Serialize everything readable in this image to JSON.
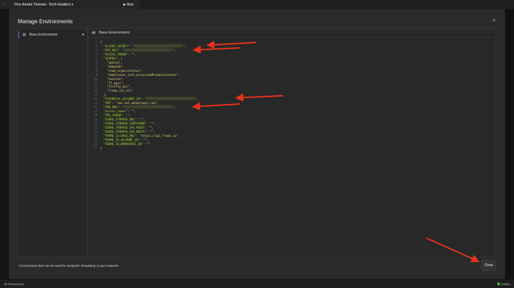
{
  "topbar": {
    "back_icon": "chevron-left-icon",
    "title": "One Adobe Tutorial - Tech Insiders ▾",
    "run": "▶ Run"
  },
  "modal": {
    "title": "Manage Environments",
    "close_icon": "×",
    "sidebar": {
      "items": [
        {
          "label": "Base Environment"
        }
      ]
    },
    "editor": {
      "title": "Base Environment",
      "lines": [
        [
          [
            "p",
            "{"
          ]
        ],
        [
          [
            "k",
            "  \"CLIENT_SECRET\""
          ],
          [
            "p",
            ": "
          ],
          [
            "s",
            "\""
          ],
          [
            "r",
            ""
          ],
          [
            "s",
            "\""
          ],
          [
            "p",
            ","
          ]
        ],
        [
          [
            "k",
            "  \"API_KEY\""
          ],
          [
            "p",
            ": "
          ],
          [
            "s",
            "\""
          ],
          [
            "r",
            ""
          ],
          [
            "s",
            "\""
          ],
          [
            "p",
            ","
          ]
        ],
        [
          [
            "k",
            "  \"ACCESS_TOKEN\""
          ],
          [
            "p",
            ": "
          ],
          [
            "s",
            "\"\""
          ],
          [
            "p",
            ","
          ]
        ],
        [
          [
            "k",
            "  \"SCOPES\""
          ],
          [
            "p",
            ": ["
          ]
        ],
        [
          [
            "s",
            "    \"openid\""
          ],
          [
            "p",
            ","
          ]
        ],
        [
          [
            "s",
            "    \"AdobeID\""
          ],
          [
            "p",
            ","
          ]
        ],
        [
          [
            "s",
            "    \"read_organizations\""
          ],
          [
            "p",
            ","
          ]
        ],
        [
          [
            "s",
            "    \"additional_info.projectedProductContext\""
          ],
          [
            "p",
            ","
          ]
        ],
        [
          [
            "s",
            "    \"session\""
          ],
          [
            "p",
            ","
          ]
        ],
        [
          [
            "s",
            "    \"ff_apis\""
          ],
          [
            "p",
            ","
          ]
        ],
        [
          [
            "s",
            "    \"firefly_api\""
          ],
          [
            "p",
            ","
          ]
        ],
        [
          [
            "s",
            "    \"frame.s2s.all\""
          ]
        ],
        [
          [
            "p",
            "  ],"
          ]
        ],
        [
          [
            "k",
            "  \"TECHNICAL_ACCOUNT_ID\""
          ],
          [
            "p",
            ": "
          ],
          [
            "s",
            "\""
          ],
          [
            "r",
            ""
          ],
          [
            "s",
            "\""
          ],
          [
            "p",
            ","
          ]
        ],
        [
          [
            "k",
            "  \"IMS\""
          ],
          [
            "p",
            ": "
          ],
          [
            "s",
            "\"ims-na1.adobelogin.com\""
          ],
          [
            "p",
            ","
          ]
        ],
        [
          [
            "k",
            "  \"IMS_ORG\""
          ],
          [
            "p",
            ": "
          ],
          [
            "s",
            "\""
          ],
          [
            "r",
            ""
          ],
          [
            "s",
            "\""
          ],
          [
            "p",
            ","
          ]
        ],
        [
          [
            "k",
            "  \"access_token\""
          ],
          [
            "p",
            ": "
          ],
          [
            "s",
            "\"\""
          ],
          [
            "p",
            ","
          ]
        ],
        [
          [
            "k",
            "  \"IMS_TOKEN\""
          ],
          [
            "p",
            ": "
          ],
          [
            "s",
            "\"\""
          ],
          [
            "p",
            ","
          ]
        ],
        [
          [
            "k",
            "  \"AZURE_STORAGE_URL\""
          ],
          [
            "p",
            ": "
          ],
          [
            "s",
            "\"\""
          ],
          [
            "p",
            ","
          ]
        ],
        [
          [
            "k",
            "  \"AZURE_STORAGE_CONTAINER\""
          ],
          [
            "p",
            ": "
          ],
          [
            "s",
            "\"\""
          ],
          [
            "p",
            ","
          ]
        ],
        [
          [
            "k",
            "  \"AZURE_STORAGE_SAS_READ\""
          ],
          [
            "p",
            ": "
          ],
          [
            "s",
            "\"\""
          ],
          [
            "p",
            ","
          ]
        ],
        [
          [
            "k",
            "  \"AZURE_STORAGE_SAS_WRITE\""
          ],
          [
            "p",
            ": "
          ],
          [
            "s",
            "\"\""
          ],
          [
            "p",
            ","
          ]
        ],
        [
          [
            "k",
            "  \"FRAME_IO_BASE_URL\""
          ],
          [
            "p",
            ": "
          ],
          [
            "s",
            "\"https://api.frame.io\""
          ],
          [
            "p",
            ","
          ]
        ],
        [
          [
            "k",
            "  \"FRAME_IO_ACCOUNT_ID\""
          ],
          [
            "p",
            ": "
          ],
          [
            "s",
            "\"\""
          ],
          [
            "p",
            ","
          ]
        ],
        [
          [
            "k",
            "  \"FRAME_IO_WORKSPACE_ID\""
          ],
          [
            "p",
            ": "
          ],
          [
            "s",
            "\"\""
          ]
        ],
        [
          [
            "p",
            "}"
          ]
        ]
      ]
    },
    "footer_note": "* Environment data can be used for Nunjucks Templating in your requests.",
    "close_button": "Close"
  },
  "bottombar": {
    "preferences": "⚙ Preferences",
    "status": "Online"
  },
  "colors": {
    "accent": "#8a6ad8",
    "arrow": "#e8321e"
  }
}
